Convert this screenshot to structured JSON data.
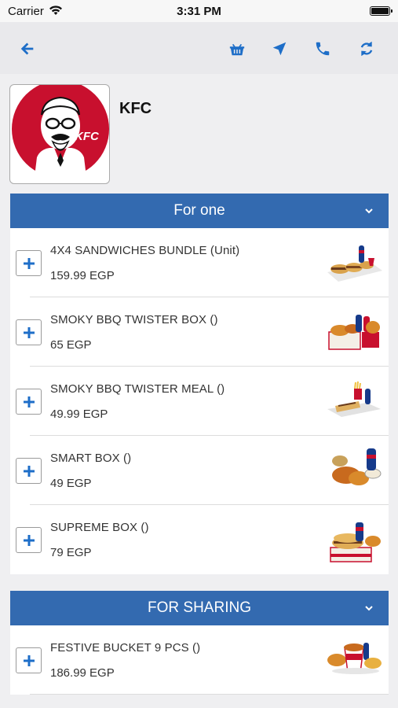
{
  "status_bar": {
    "carrier": "Carrier",
    "time": "3:31 PM"
  },
  "nav": {
    "back_icon": "arrow-left-icon",
    "basket_icon": "basket-icon",
    "location_icon": "location-arrow-icon",
    "phone_icon": "phone-icon",
    "refresh_icon": "refresh-icon",
    "icon_color": "#1e6ec8"
  },
  "restaurant": {
    "name": "KFC",
    "logo_text": "KFC"
  },
  "colors": {
    "section_header": "#336ab0",
    "page_background": "#efeff1",
    "brand_red": "#c8102e"
  },
  "sections": [
    {
      "title": "For one",
      "items": [
        {
          "name": "4X4 SANDWICHES BUNDLE  (Unit)",
          "price": "159.99 EGP"
        },
        {
          "name": "SMOKY BBQ TWISTER BOX   ()",
          "price": "65 EGP"
        },
        {
          "name": "SMOKY BBQ TWISTER MEAL   ()",
          "price": "49.99 EGP"
        },
        {
          "name": "SMART BOX   ()",
          "price": "49 EGP"
        },
        {
          "name": "SUPREME BOX   ()",
          "price": "79 EGP"
        }
      ]
    },
    {
      "title": "FOR SHARING",
      "items": [
        {
          "name": "FESTIVE BUCKET 9 PCS   ()",
          "price": "186.99 EGP"
        }
      ]
    }
  ]
}
